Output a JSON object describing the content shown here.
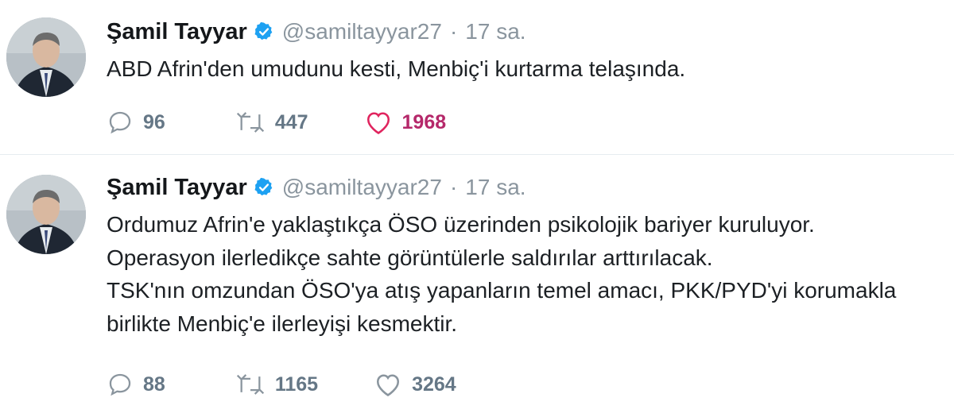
{
  "tweets": [
    {
      "author_name": "Şamil Tayyar",
      "handle": "@samiltayyar27",
      "separator": "·",
      "time": "17 sa.",
      "lines": [
        "ABD Afrin'den umudunu kesti, Menbiç'i kurtarma telaşında."
      ],
      "replies": "96",
      "retweets": "447",
      "likes": "1968",
      "liked": true
    },
    {
      "author_name": "Şamil Tayyar",
      "handle": "@samiltayyar27",
      "separator": "·",
      "time": "17 sa.",
      "lines": [
        "Ordumuz Afrin'e yaklaştıkça ÖSO üzerinden psikolojik bariyer kuruluyor.",
        "Operasyon ilerledikçe sahte görüntülerle saldırılar arttırılacak.",
        "TSK'nın omzundan ÖSO'ya atış yapanların temel amacı, PKK/PYD'yi korumakla",
        "birlikte Menbiç'e ilerleyişi kesmektir."
      ],
      "replies": "88",
      "retweets": "1165",
      "likes": "3264",
      "liked": false
    }
  ],
  "icons": {
    "reply": "reply-icon",
    "retweet": "retweet-icon",
    "like": "heart-icon",
    "verified": "verified-badge-icon"
  },
  "colors": {
    "verified": "#1da1f2",
    "liked": "#e0245e",
    "muted": "#8a959e"
  }
}
